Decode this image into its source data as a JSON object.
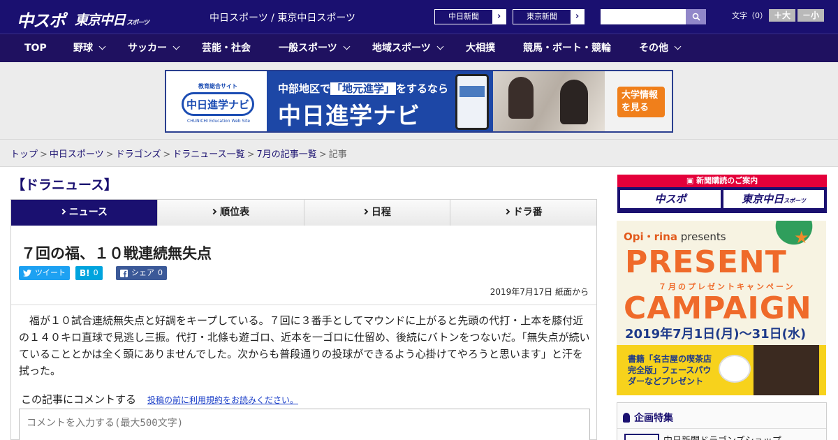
{
  "header": {
    "logo_main": "中スポ",
    "logo_sub": "東京中日",
    "logo_sub_small": "スポーツ",
    "tagline": "中日スポーツ / 東京中日スポーツ",
    "ext_links": [
      "中日新聞",
      "東京新聞"
    ],
    "search_placeholder": "",
    "font_size_label": "文字（0）",
    "font_larger": "＋大",
    "font_smaller": "－小"
  },
  "nav": [
    {
      "label": "TOP",
      "dropdown": false
    },
    {
      "label": "野球",
      "dropdown": true
    },
    {
      "label": "サッカー",
      "dropdown": true
    },
    {
      "label": "芸能・社会",
      "dropdown": false
    },
    {
      "label": "一般スポーツ",
      "dropdown": true
    },
    {
      "label": "地域スポーツ",
      "dropdown": true
    },
    {
      "label": "大相撲",
      "dropdown": false
    },
    {
      "label": "競馬・ボート・競輪",
      "dropdown": false
    },
    {
      "label": "その他",
      "dropdown": true
    }
  ],
  "banner": {
    "logo_top": "教育総合サイト",
    "logo_name": "中日進学ナビ",
    "logo_en": "CHUNICHI Education Web Site",
    "line1_pre": "中部地区で",
    "line1_em": "「地元進学」",
    "line1_post": "をするなら",
    "line2": "中日進学ナビ",
    "cta": "大学情報を見る"
  },
  "breadcrumb": {
    "items": [
      "トップ",
      "中日スポーツ",
      "ドラゴンズ",
      "ドラニュース一覧",
      "7月の記事一覧"
    ],
    "current": "記事",
    "separator": ">"
  },
  "section_title": "【ドラニュース】",
  "tabs": [
    {
      "label": "ニュース",
      "active": true
    },
    {
      "label": "順位表",
      "active": false
    },
    {
      "label": "日程",
      "active": false
    },
    {
      "label": "ドラ番",
      "active": false
    }
  ],
  "article": {
    "title": "７回の福、１０戦連続無失点",
    "share": {
      "tweet": "ツイート",
      "hatena_icon": "B!",
      "hatena_count": "0",
      "facebook_label": "シェア",
      "facebook_count": "0"
    },
    "dateline": "2019年7月17日 紙面から",
    "body": "福が１０試合連続無失点と好調をキープしている。７回に３番手としてマウンドに上がると先頭の代打・上本を膝付近の１４０キロ直球で見逃し三振。代打・北條も遊ゴロ、近本を一ゴロに仕留め、後続にバトンをつないだ。「無失点が続いていることとかは全く頭にありませんでした。次からも普段通りの投球ができるよう心掛けてやろうと思います」と汗を拭った。",
    "comment_label": "この記事にコメントする",
    "comment_link": "投稿の前に利用規約をお読みください。",
    "comment_placeholder": "コメントを入力する(最大500文字)"
  },
  "sidebar": {
    "subscribe_title": "新聞購読のご案内",
    "subscribe_btn1": "中スポ",
    "subscribe_btn2": "東京中日",
    "subscribe_btn2_small": "スポーツ",
    "ad": {
      "brand": "Opi・rina",
      "presents": "presents",
      "word1": "PRESENT",
      "sub": "７月のプレゼントキャンペーン",
      "word2": "CAMPAIGN",
      "date": "2019年7月1日(月)〜31日(水)",
      "gift": "書籍「名古屋の喫茶店 完全版」フェースパウダーなどプレゼント"
    },
    "feature_title": "企画特集",
    "feature_item": "中日新聞ドラゴンズショップ"
  },
  "colors": {
    "brand_navy": "#1a1070",
    "nav_bg": "#1f1160",
    "link": "#1a3ec8",
    "twitter": "#1da1f2",
    "hatena": "#00a4de",
    "facebook": "#3b5998",
    "subscribe_red": "#e4003a"
  }
}
